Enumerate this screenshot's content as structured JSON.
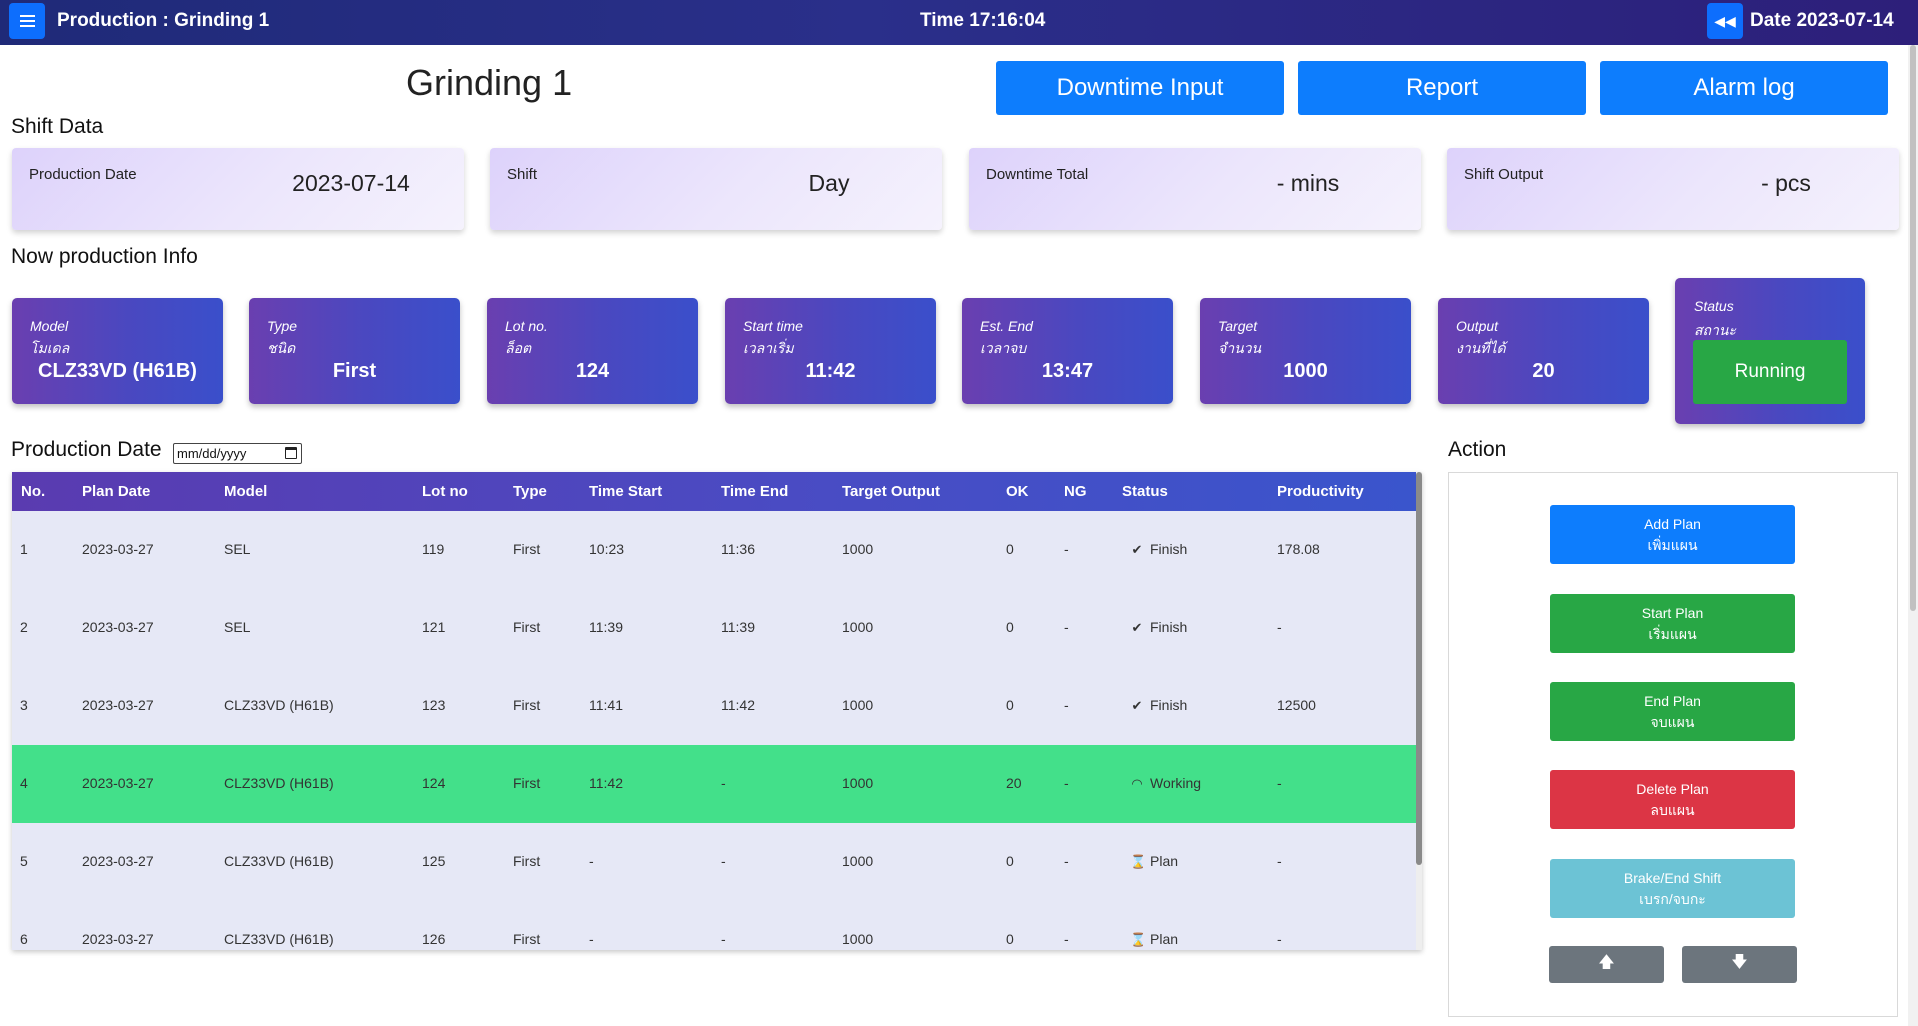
{
  "topbar": {
    "title": "Production : Grinding 1",
    "time": "Time 17:16:04",
    "date": "Date 2023-07-14"
  },
  "page_title": "Grinding 1",
  "header_buttons": {
    "downtime": "Downtime Input",
    "report": "Report",
    "alarm": "Alarm log"
  },
  "shift_data": {
    "title": "Shift Data",
    "cards": [
      {
        "label": "Production Date",
        "value": "2023-07-14"
      },
      {
        "label": "Shift",
        "value": "Day"
      },
      {
        "label": "Downtime Total",
        "value": "- mins"
      },
      {
        "label": "Shift Output",
        "value": "- pcs"
      }
    ]
  },
  "now_info": {
    "title": "Now production Info",
    "cards": [
      {
        "label_en": "Model",
        "label_th": "โมเดล",
        "value": "CLZ33VD (H61B)"
      },
      {
        "label_en": "Type",
        "label_th": "ชนิด",
        "value": "First"
      },
      {
        "label_en": "Lot no.",
        "label_th": "ล็อต",
        "value": "124"
      },
      {
        "label_en": "Start time",
        "label_th": "เวลาเริ่ม",
        "value": "11:42"
      },
      {
        "label_en": "Est. End",
        "label_th": "เวลาจบ",
        "value": "13:47"
      },
      {
        "label_en": "Target",
        "label_th": "จำนวน",
        "value": "1000"
      },
      {
        "label_en": "Output",
        "label_th": "งานที่ได้",
        "value": "20"
      }
    ],
    "status": {
      "label_en": "Status",
      "label_th": "สถานะ",
      "value": "Running",
      "color": "#28a745"
    }
  },
  "production_date": {
    "label": "Production Date",
    "placeholder": "mm/dd/yyyy"
  },
  "table": {
    "headers": [
      "No.",
      "Plan Date",
      "Model",
      "Lot no",
      "Type",
      "Time Start",
      "Time End",
      "Target Output",
      "OK",
      "NG",
      "Status",
      "Productivity"
    ],
    "rows": [
      [
        "1",
        "2023-03-27",
        "SEL",
        "119",
        "First",
        "10:23",
        "11:36",
        "1000",
        "0",
        "-",
        "Finish",
        "178.08"
      ],
      [
        "2",
        "2023-03-27",
        "SEL",
        "121",
        "First",
        "11:39",
        "11:39",
        "1000",
        "0",
        "-",
        "Finish",
        "-"
      ],
      [
        "3",
        "2023-03-27",
        "CLZ33VD (H61B)",
        "123",
        "First",
        "11:41",
        "11:42",
        "1000",
        "0",
        "-",
        "Finish",
        "12500"
      ],
      [
        "4",
        "2023-03-27",
        "CLZ33VD (H61B)",
        "124",
        "First",
        "11:42",
        "-",
        "1000",
        "20",
        "-",
        "Working",
        "-"
      ],
      [
        "5",
        "2023-03-27",
        "CLZ33VD (H61B)",
        "125",
        "First",
        "-",
        "-",
        "1000",
        "0",
        "-",
        "Plan",
        "-"
      ],
      [
        "6",
        "2023-03-27",
        "CLZ33VD (H61B)",
        "126",
        "First",
        "-",
        "-",
        "1000",
        "0",
        "-",
        "Plan",
        "-"
      ]
    ],
    "status_icons": {
      "Finish": "check-icon",
      "Working": "spinner-icon",
      "Plan": "hourglass-icon"
    },
    "working_row_color": "#43e08a"
  },
  "action": {
    "title": "Action",
    "buttons": [
      {
        "en": "Add Plan",
        "th": "เพิ่มแผน",
        "color": "#0d7dfd"
      },
      {
        "en": "Start Plan",
        "th": "เริ่มแผน",
        "color": "#28a745"
      },
      {
        "en": "End Plan",
        "th": "จบแผน",
        "color": "#28a745"
      },
      {
        "en": "Delete Plan",
        "th": "ลบแผน",
        "color": "#dc3545"
      },
      {
        "en": "Brake/End Shift",
        "th": "เบรก/จบกะ",
        "color": "#6cc3d5"
      }
    ]
  },
  "colors": {
    "primary": "#0d7dfd",
    "header_gradient_start": "#5a3bb0",
    "header_gradient_end": "#3a55cc"
  }
}
